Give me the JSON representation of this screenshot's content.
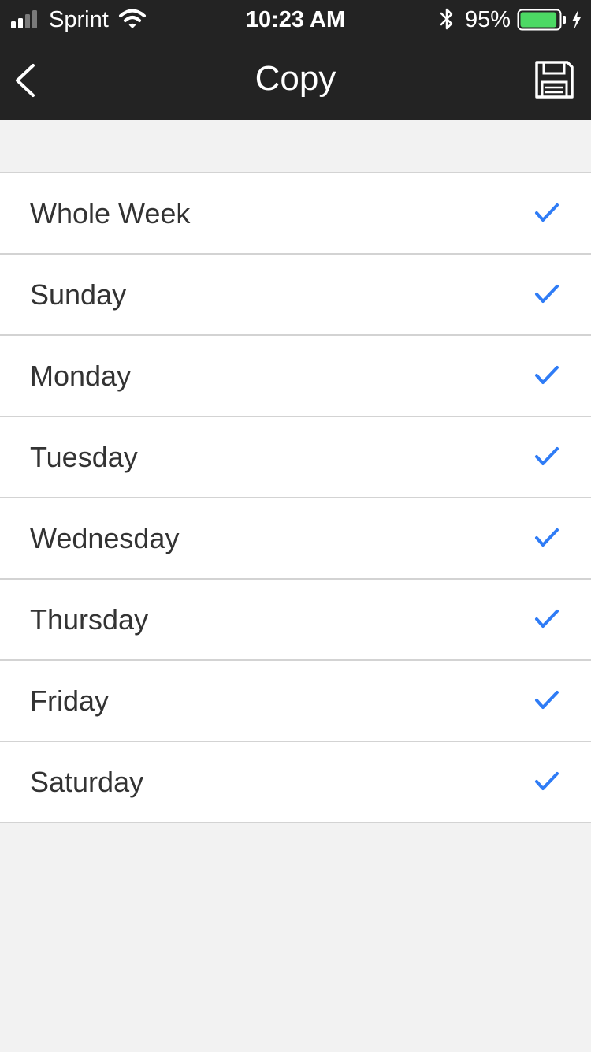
{
  "status_bar": {
    "carrier": "Sprint",
    "time": "10:23 AM",
    "battery_percent": "95%",
    "battery_level": 0.95,
    "signal_bars": 2,
    "signal_total": 4,
    "battery_color": "#4cd964"
  },
  "nav": {
    "title": "Copy",
    "back_icon": "chevron-left-icon",
    "save_icon": "floppy-disk-icon"
  },
  "days": [
    {
      "label": "Whole Week",
      "checked": true
    },
    {
      "label": "Sunday",
      "checked": true
    },
    {
      "label": "Monday",
      "checked": true
    },
    {
      "label": "Tuesday",
      "checked": true
    },
    {
      "label": "Wednesday",
      "checked": true
    },
    {
      "label": "Thursday",
      "checked": true
    },
    {
      "label": "Friday",
      "checked": true
    },
    {
      "label": "Saturday",
      "checked": true
    }
  ],
  "colors": {
    "header_background": "#232323",
    "page_background": "#f2f2f2",
    "checkmark": "#2f7cf6"
  }
}
